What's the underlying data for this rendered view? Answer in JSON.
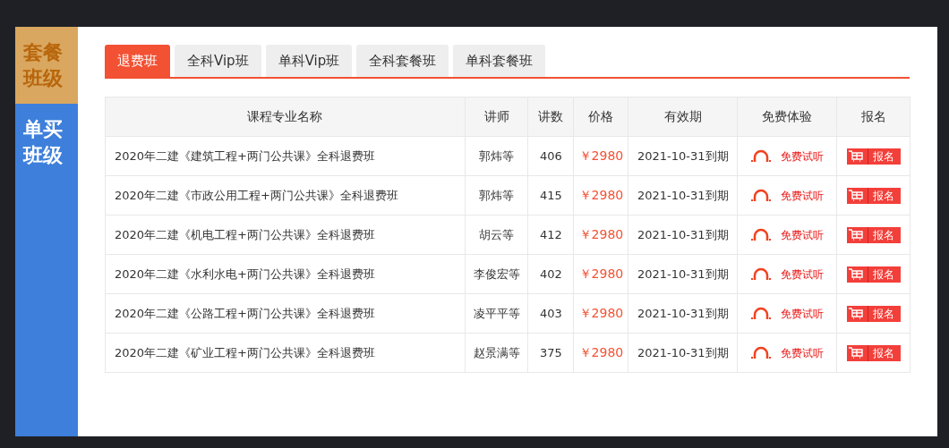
{
  "sidebar": {
    "items": [
      {
        "label": "套餐班级",
        "color": "#d9a75f"
      },
      {
        "label": "单买班级",
        "color": "#3d7fdb"
      }
    ]
  },
  "tabs": [
    {
      "label": "退费班",
      "selected": true
    },
    {
      "label": "全科Vip班",
      "selected": false
    },
    {
      "label": "单科Vip班",
      "selected": false
    },
    {
      "label": "全科套餐班",
      "selected": false
    },
    {
      "label": "单科套餐班",
      "selected": false
    }
  ],
  "table": {
    "columns": [
      "课程专业名称",
      "讲师",
      "讲数",
      "价格",
      "有效期",
      "免费体验",
      "报名"
    ],
    "rows": [
      {
        "name": "2020年二建《建筑工程+两门公共课》全科退费班",
        "teacher": "郭炜等",
        "lessons": "406",
        "price": "￥2980",
        "expiry": "2021-10-31到期",
        "trial": "免费试听",
        "enroll": "报名"
      },
      {
        "name": "2020年二建《市政公用工程+两门公共课》全科退费班",
        "teacher": "郭炜等",
        "lessons": "415",
        "price": "￥2980",
        "expiry": "2021-10-31到期",
        "trial": "免费试听",
        "enroll": "报名"
      },
      {
        "name": "2020年二建《机电工程+两门公共课》全科退费班",
        "teacher": "胡云等",
        "lessons": "412",
        "price": "￥2980",
        "expiry": "2021-10-31到期",
        "trial": "免费试听",
        "enroll": "报名"
      },
      {
        "name": "2020年二建《水利水电+两门公共课》全科退费班",
        "teacher": "李俊宏等",
        "lessons": "402",
        "price": "￥2980",
        "expiry": "2021-10-31到期",
        "trial": "免费试听",
        "enroll": "报名"
      },
      {
        "name": "2020年二建《公路工程+两门公共课》全科退费班",
        "teacher": "凌平平等",
        "lessons": "403",
        "price": "￥2980",
        "expiry": "2021-10-31到期",
        "trial": "免费试听",
        "enroll": "报名"
      },
      {
        "name": "2020年二建《矿业工程+两门公共课》全科退费班",
        "teacher": "赵景满等",
        "lessons": "375",
        "price": "￥2980",
        "expiry": "2021-10-31到期",
        "trial": "免费试听",
        "enroll": "报名"
      }
    ]
  }
}
